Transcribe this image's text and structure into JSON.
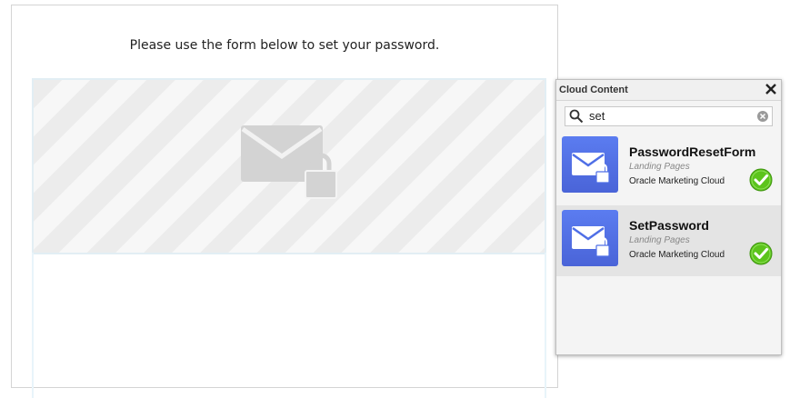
{
  "canvas": {
    "intro_text": "Please use the form below to set your password."
  },
  "panel": {
    "title": "Cloud Content",
    "search": {
      "value": "set"
    },
    "items": [
      {
        "name": "PasswordResetForm",
        "category": "Landing Pages",
        "source": "Oracle Marketing Cloud",
        "selected": false
      },
      {
        "name": "SetPassword",
        "category": "Landing Pages",
        "source": "Oracle Marketing Cloud",
        "selected": true
      }
    ]
  },
  "colors": {
    "thumb_blue": "#4f6fe6",
    "check_green": "#5cc41c"
  }
}
